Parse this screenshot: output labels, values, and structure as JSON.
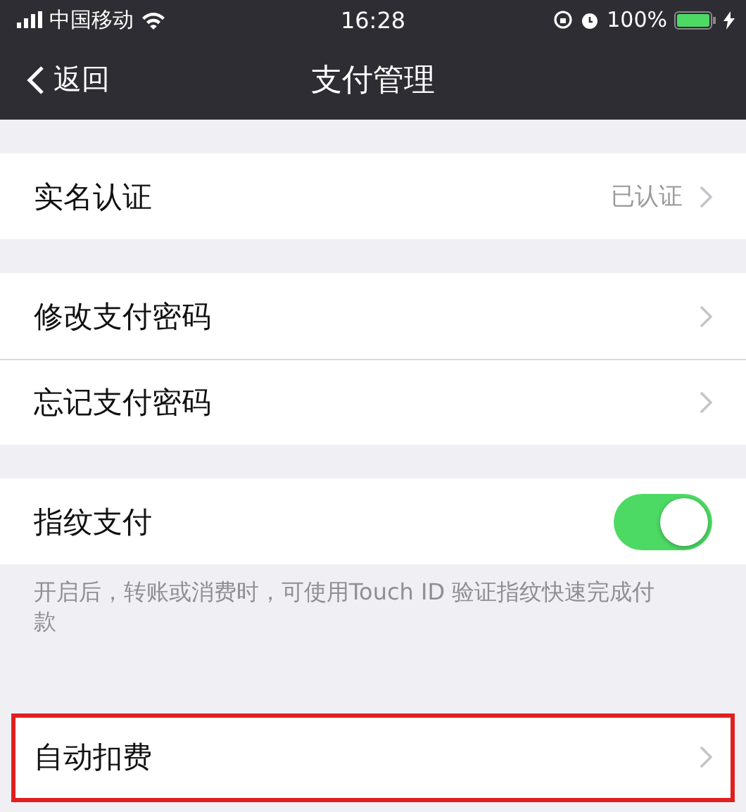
{
  "status_bar": {
    "carrier": "中国移动",
    "time": "16:28",
    "battery": "100%"
  },
  "nav": {
    "back": "返回",
    "title": "支付管理"
  },
  "sections": [
    {
      "items": [
        {
          "kind": "link",
          "label": "实名认证",
          "value": "已认证",
          "highlighted": false
        }
      ]
    },
    {
      "items": [
        {
          "kind": "link",
          "label": "修改支付密码",
          "highlighted": false
        },
        {
          "kind": "link",
          "label": "忘记支付密码",
          "highlighted": false
        }
      ]
    },
    {
      "items": [
        {
          "kind": "toggle",
          "label": "指纹支付",
          "on": true,
          "highlighted": false
        }
      ],
      "note": "开启后，转账或消费时，可使用Touch ID 验证指纹快速完成付款"
    },
    {
      "items": [
        {
          "kind": "link",
          "label": "自动扣费",
          "highlighted": true
        }
      ]
    }
  ]
}
